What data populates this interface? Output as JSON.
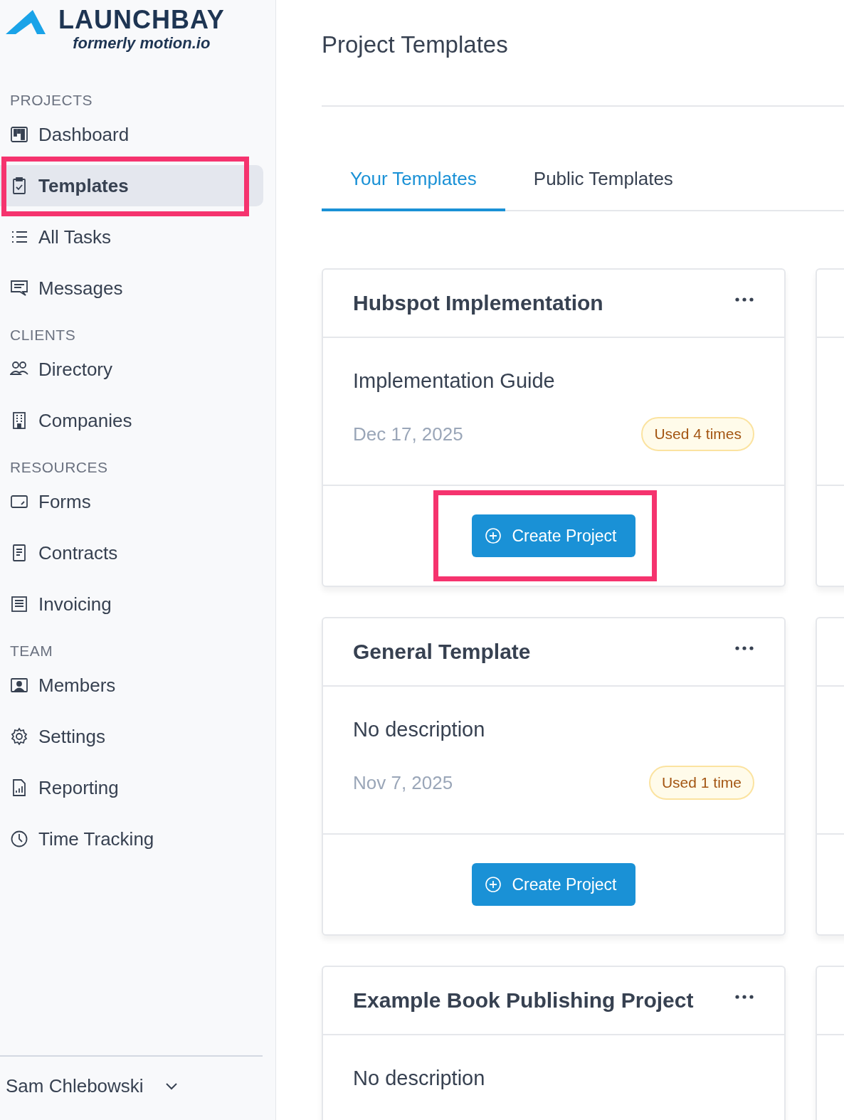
{
  "brand": {
    "name": "LAUNCHBAY",
    "tagline": "formerly motion.io"
  },
  "sidebar": {
    "sections": [
      {
        "title": "PROJECTS",
        "items": [
          {
            "label": "Dashboard",
            "selected": false,
            "highlighted": false
          },
          {
            "label": "Templates",
            "selected": true,
            "highlighted": true
          },
          {
            "label": "All Tasks",
            "selected": false,
            "highlighted": false
          },
          {
            "label": "Messages",
            "selected": false,
            "highlighted": false
          }
        ]
      },
      {
        "title": "CLIENTS",
        "items": [
          {
            "label": "Directory",
            "selected": false,
            "highlighted": false
          },
          {
            "label": "Companies",
            "selected": false,
            "highlighted": false
          }
        ]
      },
      {
        "title": "RESOURCES",
        "items": [
          {
            "label": "Forms",
            "selected": false,
            "highlighted": false
          },
          {
            "label": "Contracts",
            "selected": false,
            "highlighted": false
          },
          {
            "label": "Invoicing",
            "selected": false,
            "highlighted": false
          }
        ]
      },
      {
        "title": "TEAM",
        "items": [
          {
            "label": "Members",
            "selected": false,
            "highlighted": false
          },
          {
            "label": "Settings",
            "selected": false,
            "highlighted": false
          },
          {
            "label": "Reporting",
            "selected": false,
            "highlighted": false
          },
          {
            "label": "Time Tracking",
            "selected": false,
            "highlighted": false
          }
        ]
      }
    ],
    "user": "Sam Chlebowski"
  },
  "page_title": "Project Templates",
  "tabs": [
    {
      "label": "Your Templates",
      "selected": true
    },
    {
      "label": "Public Templates",
      "selected": false
    }
  ],
  "cards": [
    {
      "title": "Hubspot Implementation",
      "description": "Implementation Guide",
      "date": "Dec 17, 2025",
      "usage": "Used 4 times",
      "button": "Create Project",
      "highlighted": true
    },
    {
      "title": "General Template",
      "description": "No description",
      "date": "Nov 7, 2025",
      "usage": "Used 1 time",
      "button": "Create Project",
      "highlighted": false
    },
    {
      "title": "Example Book Publishing Project",
      "description": "No description"
    }
  ]
}
